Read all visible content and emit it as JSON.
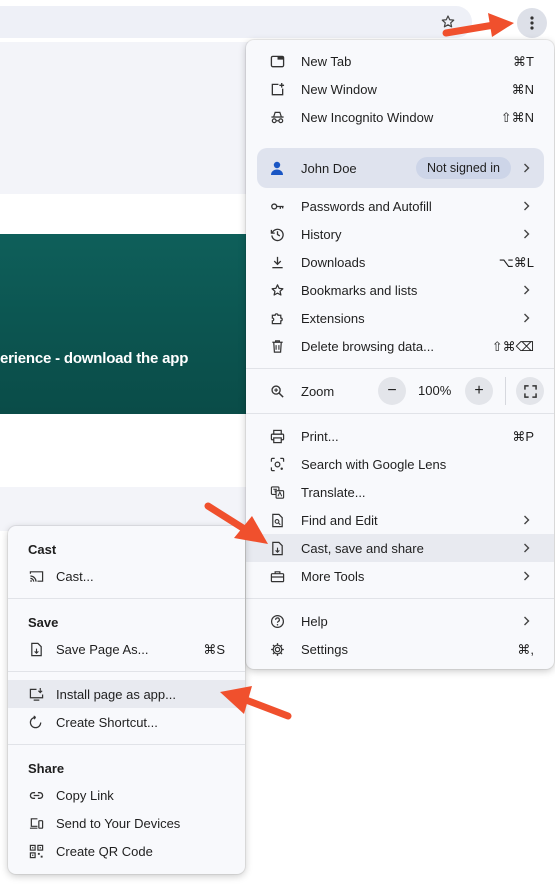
{
  "banner": {
    "text": "erience - download the app"
  },
  "main_menu": {
    "new_tab": {
      "label": "New Tab",
      "shortcut": "⌘T"
    },
    "new_window": {
      "label": "New Window",
      "shortcut": "⌘N"
    },
    "new_incognito": {
      "label": "New Incognito Window",
      "shortcut": "⇧⌘N"
    },
    "profile": {
      "name": "John Doe",
      "status": "Not signed in"
    },
    "passwords": {
      "label": "Passwords and Autofill"
    },
    "history": {
      "label": "History"
    },
    "downloads": {
      "label": "Downloads",
      "shortcut": "⌥⌘L"
    },
    "bookmarks": {
      "label": "Bookmarks and lists"
    },
    "extensions": {
      "label": "Extensions"
    },
    "delete_data": {
      "label": "Delete browsing data...",
      "shortcut": "⇧⌘⌫"
    },
    "zoom": {
      "label": "Zoom",
      "value": "100%",
      "minus": "−",
      "plus": "+"
    },
    "print": {
      "label": "Print...",
      "shortcut": "⌘P"
    },
    "lens": {
      "label": "Search with Google Lens"
    },
    "translate": {
      "label": "Translate..."
    },
    "find_edit": {
      "label": "Find and Edit"
    },
    "cast_save_share": {
      "label": "Cast, save and share"
    },
    "more_tools": {
      "label": "More Tools"
    },
    "help": {
      "label": "Help"
    },
    "settings": {
      "label": "Settings",
      "shortcut": "⌘,"
    }
  },
  "sub_menu": {
    "cast_title": "Cast",
    "cast": {
      "label": "Cast..."
    },
    "save_title": "Save",
    "save_page": {
      "label": "Save Page As...",
      "shortcut": "⌘S"
    },
    "install_app": {
      "label": "Install page as app..."
    },
    "create_shortcut": {
      "label": "Create Shortcut..."
    },
    "share_title": "Share",
    "copy_link": {
      "label": "Copy Link"
    },
    "send_devices": {
      "label": "Send to Your Devices"
    },
    "qr_code": {
      "label": "Create QR Code"
    }
  },
  "colors": {
    "accent_arrow": "#f0502d",
    "menu_bg": "#f8f9fc",
    "profile_bg": "#dfe3ee",
    "banner": "#0e5f5a"
  }
}
